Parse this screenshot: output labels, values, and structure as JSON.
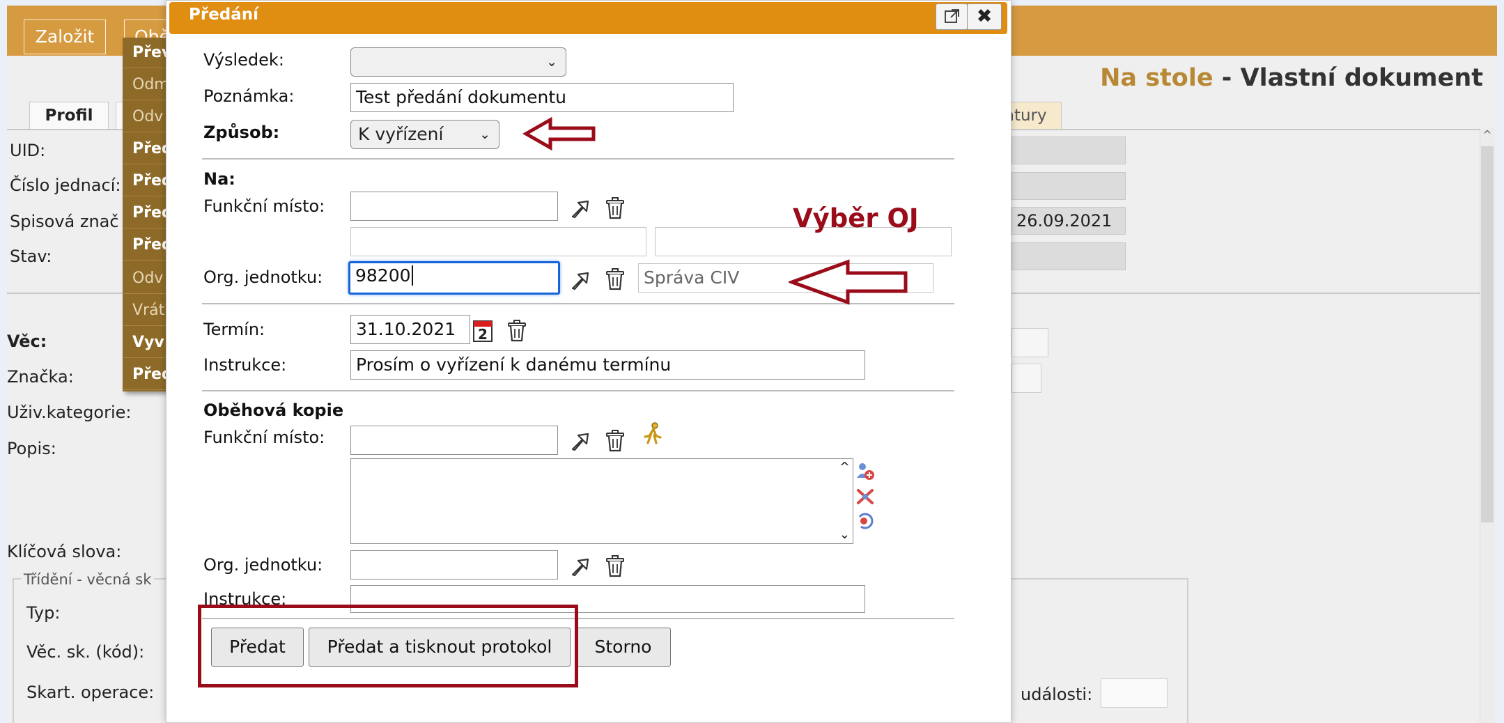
{
  "app": {
    "toolbar": {
      "create_label": "Založit",
      "circulation_label": "Oběh"
    },
    "heading": {
      "location": "Na stole",
      "separator": " - ",
      "doc_type": "Vlastní dokument"
    },
    "tabs": {
      "profile": "Profil",
      "signatures": "ntury"
    },
    "fields": {
      "uid": "UID:",
      "ref_number": "Číslo jednací:",
      "file_mark": "Spisová znač",
      "status": "Stav:",
      "subject": "Věc:",
      "mark": "Značka:",
      "user_category": "Uživ.kategorie:",
      "description": "Popis:",
      "keywords": "Klíčová slova:",
      "type": "Typ:",
      "subject_group": "Věc. sk. (kód):",
      "shredding_op": "Skart. operace:",
      "event": "události:",
      "date_value": "26.09.2021"
    },
    "sorting_legend": "Třídění - věcná sk",
    "menu_items": [
      "Přev",
      "Odm",
      "Odv",
      "Před",
      "Před",
      "Před",
      "Před",
      "Odv",
      "Vrát",
      "Vyv",
      "Před"
    ]
  },
  "dialog": {
    "title": "Předání",
    "result": {
      "label": "Výsledek:",
      "value": ""
    },
    "note": {
      "label": "Poznámka:",
      "value": "Test předání dokumentu"
    },
    "method": {
      "label": "Způsob:",
      "value": "K vyřízení"
    },
    "to": {
      "heading": "Na:",
      "function_place": {
        "label": "Funkční místo:",
        "value": ""
      },
      "org_unit": {
        "label": "Org. jednotku:",
        "value": "98200",
        "name": "Správa CIV"
      }
    },
    "deadline": {
      "label": "Termín:",
      "value": "31.10.2021"
    },
    "instructions": {
      "label": "Instrukce:",
      "value": "Prosím o vyřízení k danému termínu"
    },
    "copy": {
      "heading": "Oběhová kopie",
      "function_place": {
        "label": "Funkční místo:",
        "value": ""
      },
      "org_unit": {
        "label": "Org. jednotku:",
        "value": ""
      },
      "instructions": {
        "label": "Instrukce:",
        "value": ""
      }
    },
    "buttons": {
      "submit": "Předat",
      "submit_print": "Předat a tisknout protokol",
      "cancel": "Storno"
    },
    "calendar_day": "2"
  },
  "annotations": {
    "org_unit_callout": "Výběr OJ",
    "color": "#9a0c1a"
  },
  "colors": {
    "dialog_title": "#e08e12",
    "app_toolbar": "#d69a40",
    "focus": "#1565d8"
  }
}
